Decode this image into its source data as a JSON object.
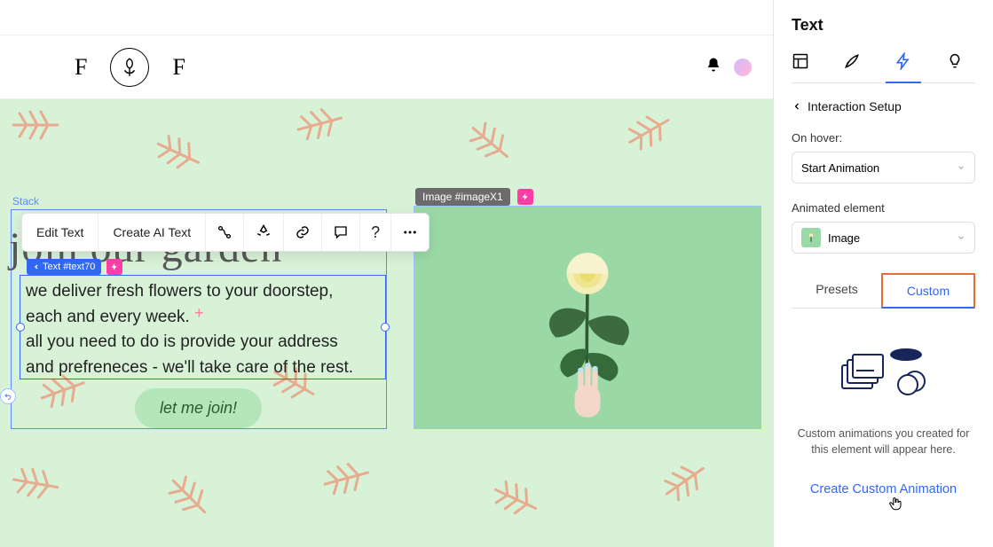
{
  "panel": {
    "title": "Text",
    "section": "Interaction Setup",
    "hover_label": "On hover:",
    "hover_value": "Start Animation",
    "animated_label": "Animated element",
    "animated_value": "Image",
    "tab_presets": "Presets",
    "tab_custom": "Custom",
    "empty_msg_line1": "Custom animations you created for",
    "empty_msg_line2": "this element will appear here.",
    "cta": "Create Custom Animation"
  },
  "site": {
    "logo_left": "F",
    "logo_right": "F"
  },
  "canvas": {
    "stack_label": "Stack",
    "headline": "join our garden",
    "para_line1": "we deliver fresh flowers to your doorstep,",
    "para_line2": "each and every week.",
    "para_line3": "all you need to do is provide your address",
    "para_line4": "and prefreneces - we'll take care of the rest.",
    "text_tag": "Text #text70",
    "image_tag": "Image #imageX1",
    "cta": "let me join!"
  },
  "toolbar": {
    "edit": "Edit Text",
    "ai": "Create AI Text"
  }
}
